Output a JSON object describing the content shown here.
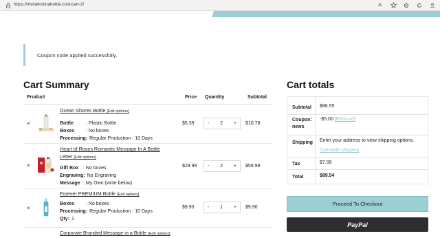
{
  "browser": {
    "url": "https://invitationinabottle.com/cart-2/",
    "icons": [
      "read-aloud-icon",
      "favorite-star-icon",
      "settings-icon",
      "refresh-icon",
      "profile-icon"
    ]
  },
  "notice": {
    "text": "Coupon code applied successfully."
  },
  "summary": {
    "title": "Cart Summary",
    "headers": {
      "product": "Product",
      "price": "Price",
      "quantity": "Quantity",
      "subtotal": "Subtotal"
    },
    "edit_label": "[Edit options]",
    "items": [
      {
        "name": "Ocean Shores Bottle",
        "meta": [
          {
            "label": "Bottle",
            "value": ": Plastic Bottle"
          },
          {
            "label": "Boxes",
            "value": ": No boxes"
          },
          {
            "label": "Processing:",
            "value": "Regular Production - 10 Days"
          }
        ],
        "price": "$5.39",
        "qty": "2",
        "subtotal": "$10.78"
      },
      {
        "name": "Heart of Roses Romantic Message In A Bottle Letter",
        "meta": [
          {
            "label": "Gift Box",
            "value": ": No boxes"
          },
          {
            "label": "Engraving:",
            "value": "No Engraving"
          },
          {
            "label": "Message",
            "value": ": My Own (write below)"
          }
        ],
        "price": "$29.99",
        "qty": "2",
        "subtotal": "$59.98"
      },
      {
        "name": "Forever PREMIUM Bottle",
        "meta": [
          {
            "label": "Boxes",
            "value": ": No boxes"
          },
          {
            "label": "Processing:",
            "value": "Regular Production - 10 Days"
          },
          {
            "label": "Qty:",
            "value": "1"
          }
        ],
        "price": "$9.90",
        "qty": "1",
        "subtotal": "$9.90"
      },
      {
        "name": "Corporate Branded Message in a Bottle"
      }
    ],
    "remove_symbol": "×",
    "minus": "-",
    "plus": "+"
  },
  "totals": {
    "title": "Cart totals",
    "subtotal_label": "Subtotal",
    "subtotal_value": "$86.55",
    "coupon_label": "Coupon: news",
    "coupon_value": "-$5.00",
    "coupon_remove": "[Remove]",
    "shipping_label": "Shipping",
    "shipping_text": "Enter your address to view shipping options.",
    "shipping_link": "Calculate shipping",
    "tax_label": "Tax",
    "tax_value": "$7.99",
    "total_label": "Total",
    "total_value": "$89.54",
    "checkout_label": "Proceed To Checkout",
    "paypal_label": "PayPal"
  }
}
